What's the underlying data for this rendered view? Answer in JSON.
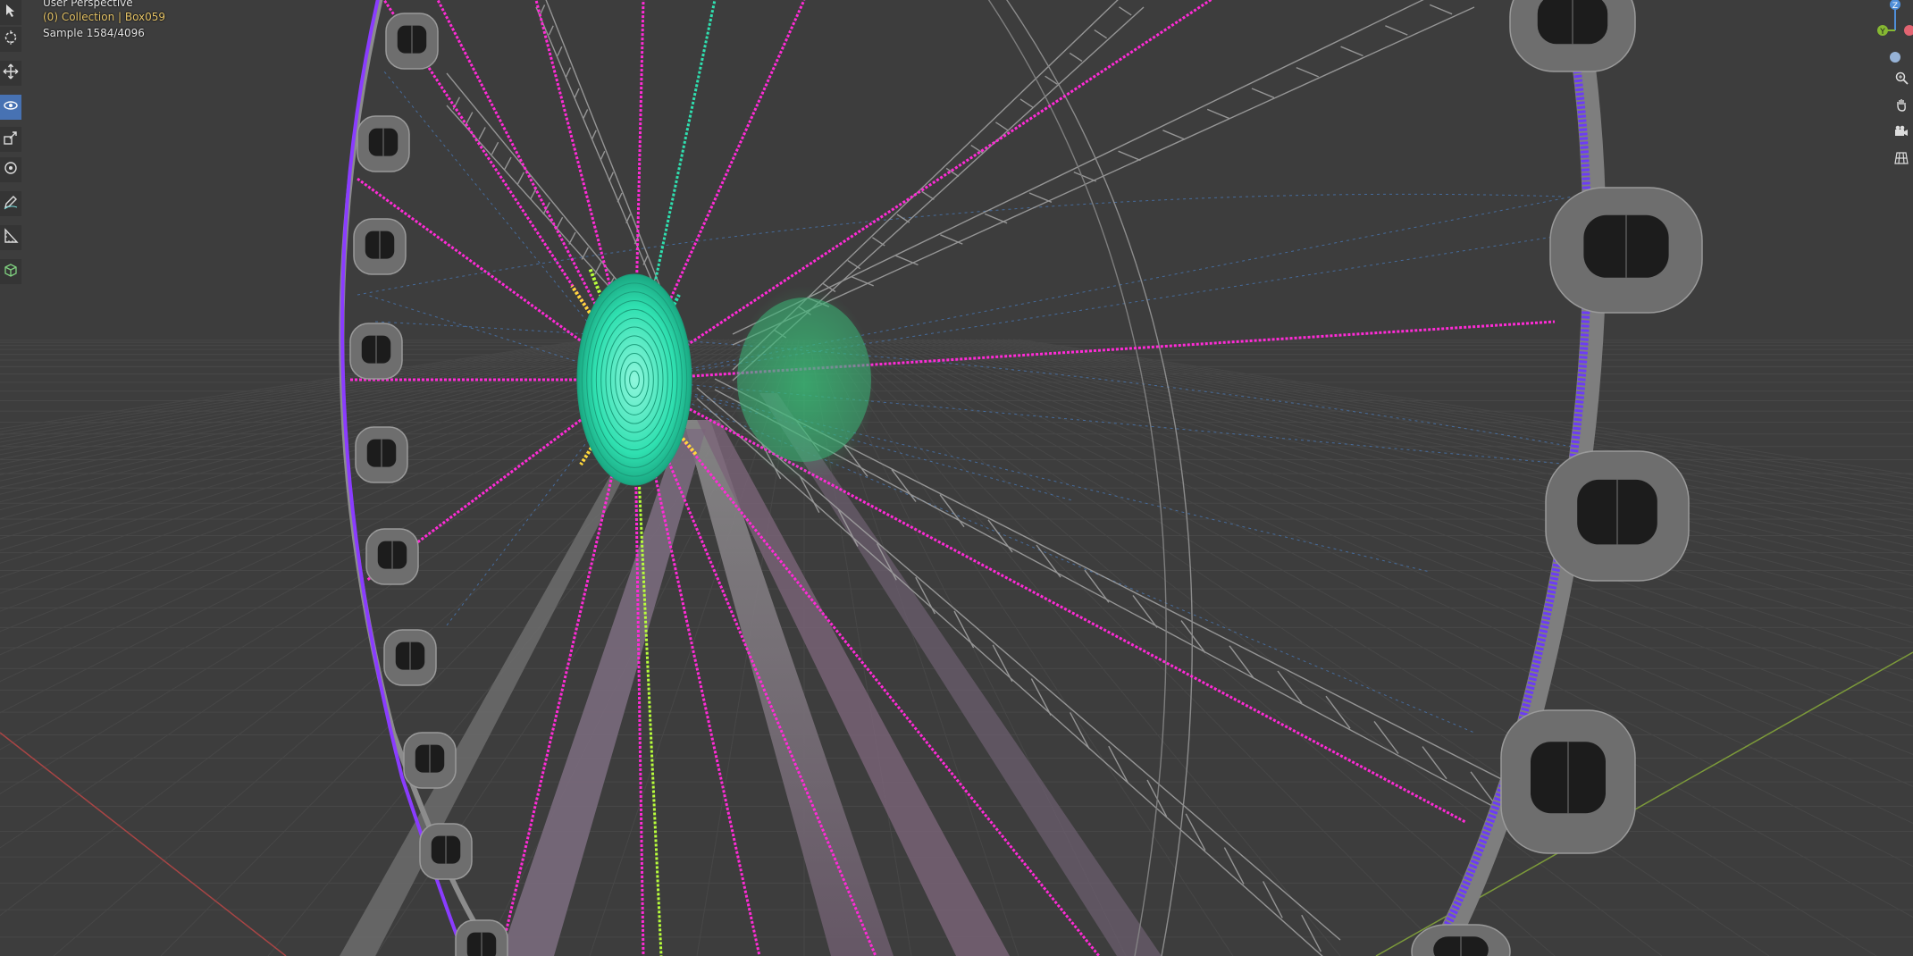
{
  "viewport": {
    "title": "User Perspective",
    "collection": "(0) Collection | Box059",
    "sample": "Sample 1584/4096"
  },
  "toolbar": {
    "tools": [
      {
        "name": "select-tool",
        "icon": "cursor-select-icon",
        "active": false
      },
      {
        "name": "cursor-tool",
        "icon": "3d-cursor-icon",
        "active": false
      },
      {
        "name": "move-tool",
        "icon": "move-arrows-icon",
        "active": false
      },
      {
        "name": "rotate-tool",
        "icon": "rotate-icon",
        "active": true
      },
      {
        "name": "scale-tool",
        "icon": "scale-icon",
        "active": false
      },
      {
        "name": "transform-tool",
        "icon": "transform-icon",
        "active": false
      },
      {
        "name": "annotate-tool",
        "icon": "pencil-icon",
        "active": false
      },
      {
        "name": "measure-tool",
        "icon": "ruler-icon",
        "active": false
      },
      {
        "name": "add-cube-tool",
        "icon": "cube-icon",
        "active": false
      }
    ]
  },
  "navigation": {
    "axes": {
      "z": "Z",
      "y": "Y"
    },
    "buttons": [
      "zoom-icon",
      "hand-pan-icon",
      "camera-icon",
      "grid-icon"
    ]
  },
  "colors": {
    "background": "#3d3d3d",
    "grid": "#4a4a4a",
    "x_axis": "#b04a4a",
    "y_axis": "#7a9a3a",
    "hub": "#2fe0b0",
    "rim_lights": "#7a3cff",
    "spoke_lights": "#ff2bd6",
    "structure": "#9a9a9a",
    "active_tool": "#4772b3",
    "collection_text": "#e8c66a"
  }
}
